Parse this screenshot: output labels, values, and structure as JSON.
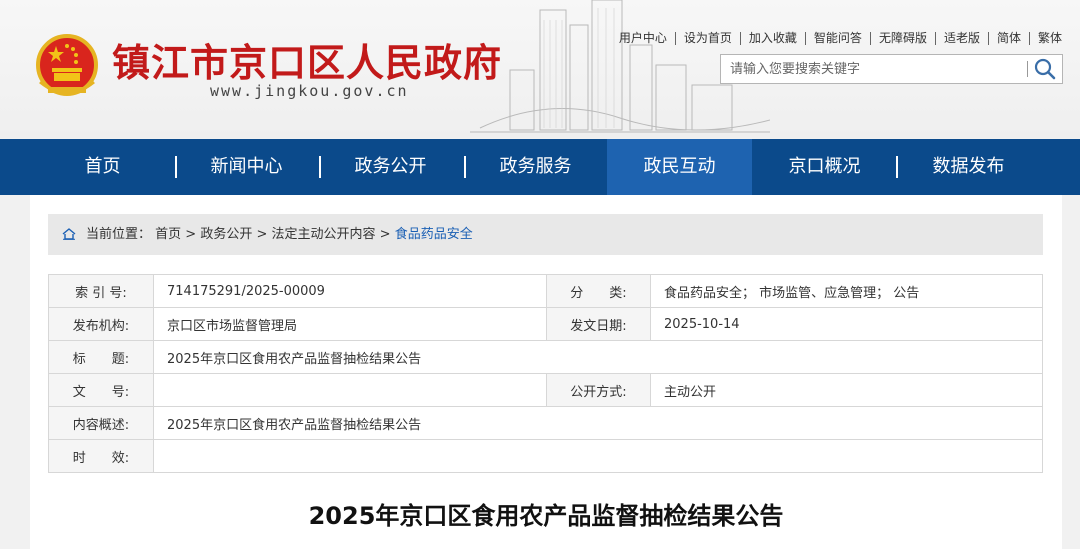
{
  "site": {
    "title": "镇江市京口区人民政府",
    "url": "www.jingkou.gov.cn"
  },
  "toplinks": [
    "用户中心",
    "设为首页",
    "加入收藏",
    "智能问答",
    "无障碍版",
    "适老版",
    "简体",
    "繁体"
  ],
  "search": {
    "placeholder": "请输入您要搜索关键字"
  },
  "nav": {
    "items": [
      "首页",
      "新闻中心",
      "政务公开",
      "政务服务",
      "政民互动",
      "京口概况",
      "数据发布"
    ],
    "active": "政民互动"
  },
  "breadcrumb": {
    "label": "当前位置：",
    "items": [
      "首页",
      "政务公开",
      "法定主动公开内容",
      "食品药品安全"
    ],
    "separator": " > "
  },
  "meta": {
    "index_label": "索 引 号:",
    "index_value": "714175291/2025-00009",
    "category_label": "分　　类:",
    "category_value": "食品药品安全；  市场监管、应急管理；  公告",
    "publisher_label": "发布机构:",
    "publisher_value": "京口区市场监督管理局",
    "date_label": "发文日期:",
    "date_value": "2025-10-14",
    "title_label": "标　　题:",
    "title_value": "2025年京口区食用农产品监督抽检结果公告",
    "docno_label": "文　　号:",
    "docno_value": "",
    "disclosure_label": "公开方式:",
    "disclosure_value": "主动公开",
    "summary_label": "内容概述:",
    "summary_value": "2025年京口区食用农产品监督抽检结果公告",
    "validity_label": "时　　效:",
    "validity_value": ""
  },
  "article": {
    "title": "2025年京口区食用农产品监督抽检结果公告"
  },
  "colors": {
    "nav_bg": "#0b4a8b",
    "nav_active": "#1e63b0",
    "title_red": "#c21a1a",
    "link_blue": "#1a5fb4"
  }
}
